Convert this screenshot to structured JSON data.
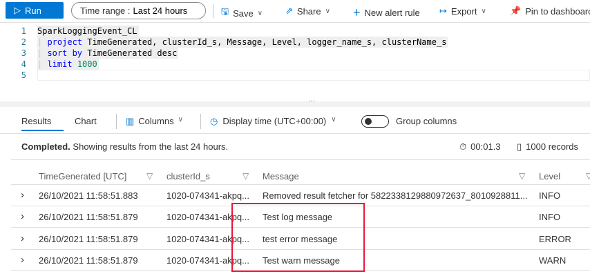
{
  "toolbar": {
    "run": "Run",
    "time_range_label": "Time range :",
    "time_range_value": "Last 24 hours",
    "save": "Save",
    "share": "Share",
    "new_alert": "New alert rule",
    "export": "Export",
    "pin": "Pin to dashboard"
  },
  "editor": {
    "lines": [
      {
        "n": "1",
        "parts": [
          {
            "t": "SparkLoggingEvent_CL",
            "c": ""
          }
        ]
      },
      {
        "n": "2",
        "parts": [
          {
            "t": "| ",
            "c": "bar"
          },
          {
            "t": "project",
            "c": "kw"
          },
          {
            "t": " TimeGenerated, clusterId_s, Message, Level, logger_name_s, clusterName_s",
            "c": ""
          }
        ]
      },
      {
        "n": "3",
        "parts": [
          {
            "t": "| ",
            "c": "bar"
          },
          {
            "t": "sort by",
            "c": "kw"
          },
          {
            "t": " TimeGenerated desc",
            "c": ""
          }
        ]
      },
      {
        "n": "4",
        "parts": [
          {
            "t": "| ",
            "c": "bar"
          },
          {
            "t": "limit",
            "c": "kw"
          },
          {
            "t": " ",
            "c": ""
          },
          {
            "t": "1000",
            "c": "num"
          }
        ]
      },
      {
        "n": "5",
        "parts": []
      }
    ]
  },
  "results": {
    "tab_results": "Results",
    "tab_chart": "Chart",
    "columns": "Columns",
    "display_time": "Display time (UTC+00:00)",
    "group_columns": "Group columns",
    "status_bold": "Completed.",
    "status_text": "Showing results from the last 24 hours.",
    "duration": "00:01.3",
    "records": "1000 records",
    "headers": [
      "TimeGenerated [UTC]",
      "clusterId_s",
      "Message",
      "Level"
    ],
    "rows": [
      [
        "26/10/2021 11:58:51.883",
        "1020-074341-akpq...",
        "Removed result fetcher for 5822338129880972637_8010928811...",
        "INFO"
      ],
      [
        "26/10/2021 11:58:51.879",
        "1020-074341-akpq...",
        "Test log message",
        "INFO"
      ],
      [
        "26/10/2021 11:58:51.879",
        "1020-074341-akpq...",
        "test error message",
        "ERROR"
      ],
      [
        "26/10/2021 11:58:51.879",
        "1020-074341-akpq...",
        "Test warn message",
        "WARN"
      ]
    ]
  },
  "colors": {
    "accent": "#0078d4",
    "highlight": "#e8173a"
  }
}
